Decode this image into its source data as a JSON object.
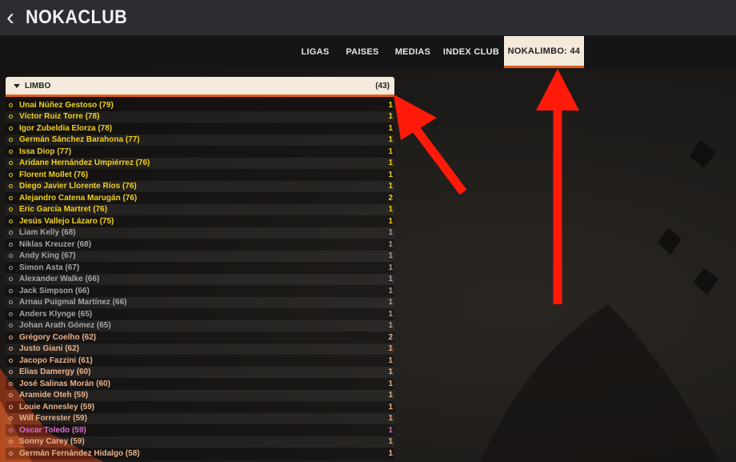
{
  "header": {
    "back_icon": "chevron-left-icon",
    "title": "NOKACLUB"
  },
  "nav": {
    "tabs": [
      "LIGAS",
      "PAISES",
      "MEDIAS",
      "INDEX CLUB",
      "NOKALIMBO: 44"
    ],
    "active": 4
  },
  "panel": {
    "title": "LIMBO",
    "count": "(43)",
    "rows": [
      {
        "name": "Unai Núñez Gestoso (79)",
        "value": "1",
        "color": "yellow"
      },
      {
        "name": "Víctor Ruiz Torre (78)",
        "value": "1",
        "color": "yellow"
      },
      {
        "name": "Igor Zubeldia Elorza (78)",
        "value": "1",
        "color": "yellow"
      },
      {
        "name": "Germán Sánchez Barahona (77)",
        "value": "1",
        "color": "yellow"
      },
      {
        "name": "Issa Diop (77)",
        "value": "1",
        "color": "yellow"
      },
      {
        "name": "Aridane Hernández Umpiérrez (76)",
        "value": "1",
        "color": "yellow"
      },
      {
        "name": "Florent Mollet (76)",
        "value": "1",
        "color": "yellow"
      },
      {
        "name": "Diego Javier Llorente Ríos (76)",
        "value": "1",
        "color": "yellow"
      },
      {
        "name": "Alejandro Catena Marugán (76)",
        "value": "2",
        "color": "yellow"
      },
      {
        "name": "Eric García Martret (76)",
        "value": "1",
        "color": "yellow"
      },
      {
        "name": "Jesús Vallejo Lázaro (75)",
        "value": "1",
        "color": "yellow"
      },
      {
        "name": "Liam Kelly (68)",
        "value": "1",
        "color": "gray"
      },
      {
        "name": "Niklas Kreuzer (68)",
        "value": "1",
        "color": "gray"
      },
      {
        "name": "Andy King (67)",
        "value": "1",
        "color": "gray"
      },
      {
        "name": "Simon Asta (67)",
        "value": "1",
        "color": "gray"
      },
      {
        "name": "Alexander Walke (66)",
        "value": "1",
        "color": "gray"
      },
      {
        "name": "Jack Simpson (66)",
        "value": "1",
        "color": "gray"
      },
      {
        "name": "Arnau Puigmal Martínez (66)",
        "value": "1",
        "color": "gray"
      },
      {
        "name": "Anders Klynge (65)",
        "value": "1",
        "color": "gray"
      },
      {
        "name": "Johan Arath Gómez (65)",
        "value": "1",
        "color": "gray"
      },
      {
        "name": "Grégory Coelho (62)",
        "value": "2",
        "color": "salmon"
      },
      {
        "name": "Justo Giani (62)",
        "value": "1",
        "color": "salmon"
      },
      {
        "name": "Jacopo Fazzini (61)",
        "value": "1",
        "color": "salmon"
      },
      {
        "name": "Elias Damergy (60)",
        "value": "1",
        "color": "salmon"
      },
      {
        "name": "José Salinas Morán (60)",
        "value": "1",
        "color": "salmon"
      },
      {
        "name": "Aramide Oteh (59)",
        "value": "1",
        "color": "salmon"
      },
      {
        "name": "Louie Annesley (59)",
        "value": "1",
        "color": "salmon"
      },
      {
        "name": "Will Forrester (59)",
        "value": "1",
        "color": "salmon"
      },
      {
        "name": "Oscar Toledo (59)",
        "value": "1",
        "color": "pink"
      },
      {
        "name": "Sonny Carey (59)",
        "value": "1",
        "color": "salmon"
      },
      {
        "name": "Germán Fernández Hidalgo (58)",
        "value": "1",
        "color": "salmon"
      }
    ]
  },
  "colors": {
    "accent": "#e0601c",
    "tab_active_bg": "#f4eadb",
    "arrow": "#ff1a0a"
  }
}
